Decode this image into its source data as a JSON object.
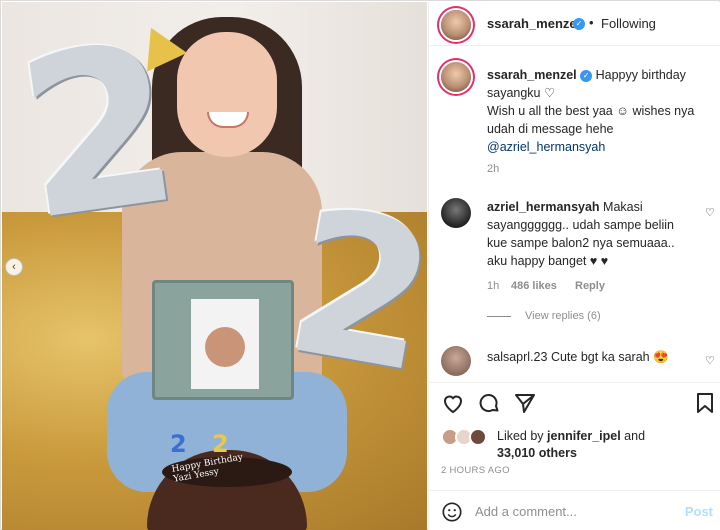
{
  "post": {
    "username": "ssarah_menzel",
    "follow_status": "Following",
    "caption": {
      "username": "ssarah_menzel",
      "text_line1": "Happyy birthday sayangku",
      "text_line2": "Wish u all the best yaa",
      "text_line3": "wishes nya udah di message hehe",
      "mention": "@azriel_hermansyah",
      "age": "2h"
    },
    "comments": [
      {
        "username": "azriel_hermansyah",
        "text": "Makasi sayangggggg.. udah sampe beliin kue sampe balon2 nya semuaaa.. aku happy banget",
        "age": "1h",
        "likes": "486 likes",
        "reply_label": "Reply",
        "view_replies": "View replies (6)"
      },
      {
        "username": "salsaprl.23",
        "text": "Cute bgt ka sarah"
      }
    ],
    "likes": {
      "prefix": "Liked by",
      "user": "jennifer_ipel",
      "connector": "and",
      "others": "33,010 others"
    },
    "timestamp": "2 HOURS AGO",
    "add_comment": {
      "placeholder": "Add a comment...",
      "post_label": "Post"
    }
  },
  "photo": {
    "balloon_left": "2",
    "balloon_right": "2",
    "candle_1": "2",
    "candle_2": "2",
    "cake_text": "Happy Birthday Yazi Yessy"
  },
  "colors": {
    "verified": "#3897f0",
    "link": "#00376b",
    "muted": "#8e8e8e",
    "post_button": "#b2dffc",
    "story_ring": "#e1306c"
  },
  "icons": [
    "heart-icon",
    "comment-icon",
    "share-icon",
    "bookmark-icon",
    "emoji-icon",
    "verified-icon",
    "carousel-prev-icon"
  ]
}
